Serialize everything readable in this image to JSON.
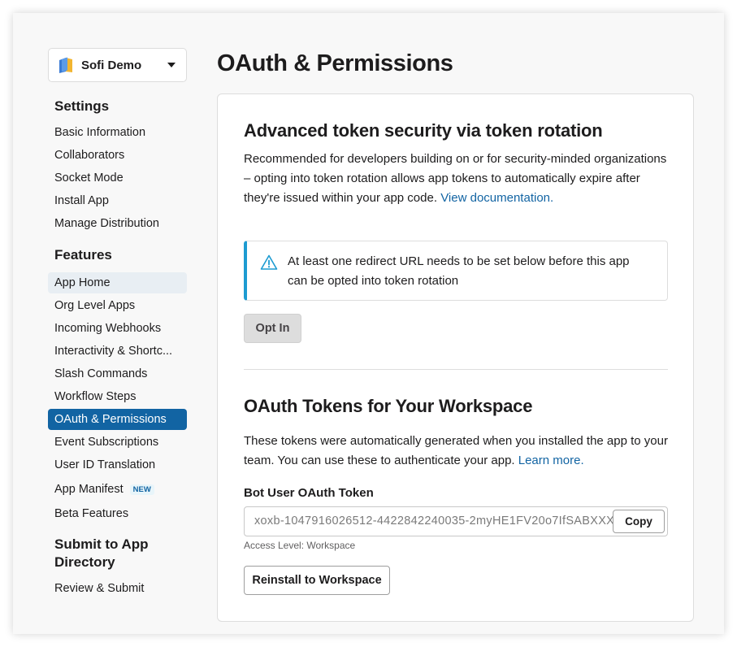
{
  "workspace": {
    "name": "Sofi Demo"
  },
  "sidebar": {
    "settings_title": "Settings",
    "settings_items": [
      {
        "label": "Basic Information"
      },
      {
        "label": "Collaborators"
      },
      {
        "label": "Socket Mode"
      },
      {
        "label": "Install App"
      },
      {
        "label": "Manage Distribution"
      }
    ],
    "features_title": "Features",
    "features_items": [
      {
        "label": "App Home"
      },
      {
        "label": "Org Level Apps"
      },
      {
        "label": "Incoming Webhooks"
      },
      {
        "label": "Interactivity & Shortc..."
      },
      {
        "label": "Slash Commands"
      },
      {
        "label": "Workflow Steps"
      },
      {
        "label": "OAuth & Permissions"
      },
      {
        "label": "Event Subscriptions"
      },
      {
        "label": "User ID Translation"
      },
      {
        "label": "App Manifest",
        "badge": "NEW"
      },
      {
        "label": "Beta Features"
      }
    ],
    "submit_title": "Submit to App Directory",
    "submit_items": [
      {
        "label": "Review & Submit"
      }
    ]
  },
  "main": {
    "title": "OAuth & Permissions",
    "rotation": {
      "heading": "Advanced token security via token rotation",
      "description": "Recommended for developers building on or for security-minded organizations – opting into token rotation allows app tokens to automatically expire after they're issued within your app code.",
      "link": "View documentation.",
      "alert": "At least one redirect URL needs to be set below before this app can be opted into token rotation",
      "opt_in_label": "Opt In"
    },
    "tokens": {
      "heading": "OAuth Tokens for Your Workspace",
      "description": "These tokens were automatically generated when you installed the app to your team. You can use these to authenticate your app.",
      "link": "Learn more.",
      "bot_token_label": "Bot User OAuth Token",
      "bot_token_value": "xoxb-1047916026512-4422842240035-2myHE1FV20o7IfSABXXXXXXX",
      "copy_label": "Copy",
      "access_level": "Access Level: Workspace",
      "reinstall_label": "Reinstall to Workspace"
    }
  },
  "colors": {
    "accent": "#1264a3",
    "alert_bar": "#1d9bd1",
    "hover_bg": "#e8eef3"
  },
  "icons": {
    "workspace_logo": "app-logo-icon",
    "caret": "chevron-down-icon",
    "alert": "warning-icon"
  }
}
